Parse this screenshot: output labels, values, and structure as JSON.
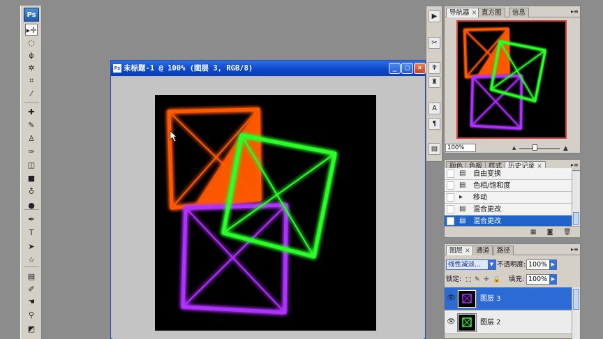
{
  "toolbox": {
    "logo": "Ps",
    "tools": [
      {
        "name": "move-tool",
        "glyph": "▸✛"
      },
      {
        "name": "marquee-tool",
        "glyph": "◌"
      },
      {
        "name": "lasso-tool",
        "glyph": "ϕ"
      },
      {
        "name": "magic-wand-tool",
        "glyph": "✲"
      },
      {
        "name": "crop-tool",
        "glyph": "⌗"
      },
      {
        "name": "slice-tool",
        "glyph": "⁄"
      },
      {
        "name": "healing-brush-tool",
        "glyph": "✚"
      },
      {
        "name": "brush-tool",
        "glyph": "✎"
      },
      {
        "name": "clone-stamp-tool",
        "glyph": "♙"
      },
      {
        "name": "history-brush-tool",
        "glyph": "✑"
      },
      {
        "name": "eraser-tool",
        "glyph": "◫"
      },
      {
        "name": "gradient-tool",
        "glyph": "■"
      },
      {
        "name": "blur-tool",
        "glyph": "♁"
      },
      {
        "name": "dodge-tool",
        "glyph": "●"
      },
      {
        "name": "pen-tool",
        "glyph": "✒"
      },
      {
        "name": "type-tool",
        "glyph": "T"
      },
      {
        "name": "path-selection-tool",
        "glyph": "➤"
      },
      {
        "name": "shape-tool",
        "glyph": "☆"
      },
      {
        "name": "notes-tool",
        "glyph": "▤"
      },
      {
        "name": "eyedropper-tool",
        "glyph": "✐"
      },
      {
        "name": "hand-tool",
        "glyph": "☚"
      },
      {
        "name": "zoom-tool",
        "glyph": "⚲"
      },
      {
        "name": "color-swatches",
        "glyph": "◩"
      }
    ]
  },
  "document": {
    "title": "未标题-1 @ 100% (图层 3, RGB/8)",
    "minimize": "_",
    "maximize": "□",
    "close": "×"
  },
  "colors": {
    "orange": "#ff5a00",
    "green": "#2cff2c",
    "purple": "#b030ff",
    "selection_blue": "#1f63c9"
  },
  "navigator": {
    "tabs": [
      "导航器",
      "直方图",
      "信息"
    ],
    "zoom": "100%"
  },
  "history": {
    "tabs": [
      "颜色",
      "色板",
      "样式",
      "历史记录"
    ],
    "items": [
      {
        "label": "自由变换",
        "icon": "doc-icon"
      },
      {
        "label": "色相/饱和度",
        "icon": "doc-icon"
      },
      {
        "label": "移动",
        "icon": "move-icon"
      },
      {
        "label": "混合更改",
        "icon": "doc-icon"
      },
      {
        "label": "混合更改",
        "icon": "doc-icon",
        "selected": true
      }
    ]
  },
  "layers": {
    "tabs": [
      "图层",
      "通道",
      "路径"
    ],
    "blend_mode": "线性减淡...",
    "opacity_label": "不透明度:",
    "opacity_value": "100%",
    "lock_label": "锁定:",
    "fill_label": "填充:",
    "fill_value": "100%",
    "rows": [
      {
        "name": "图层 3",
        "selected": true
      },
      {
        "name": "图层 2",
        "selected": false
      }
    ]
  }
}
